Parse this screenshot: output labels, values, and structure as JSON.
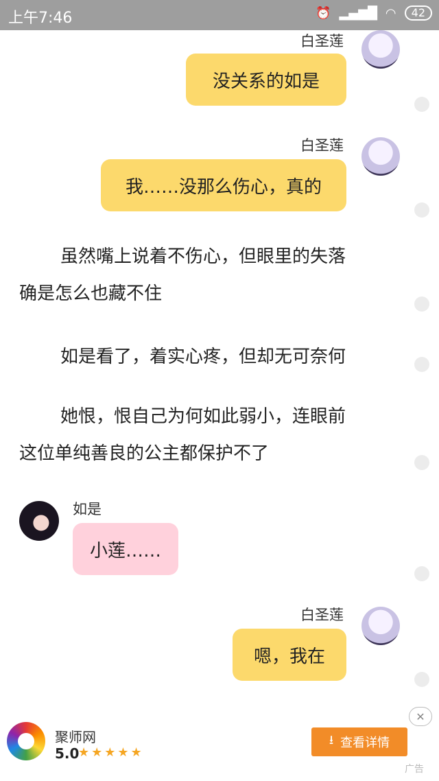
{
  "status_bar": {
    "time": "上午7:46",
    "battery": "42"
  },
  "messages": {
    "m1": {
      "name": "白圣莲",
      "text": "没关系的如是"
    },
    "m2": {
      "name": "白圣莲",
      "text": "我……没那么伤心，真的"
    },
    "m3": {
      "name": "如是",
      "text": "小莲……"
    },
    "m4": {
      "name": "白圣莲",
      "text": "嗯，我在"
    }
  },
  "narration": {
    "p1_line1": "虽然嘴上说着不伤心，但眼里的失落",
    "p1_line2": "确是怎么也藏不住",
    "p2": "如是看了，着实心疼，但却无可奈何",
    "p3_line1": "她恨，恨自己为何如此弱小，连眼前",
    "p3_line2": "这位单纯善良的公主都保护不了"
  },
  "ad": {
    "app_name": "聚师网",
    "rating": "5.0",
    "stars": "★★★★★",
    "button_label": "查看详情",
    "close": "✕",
    "tag": "广告"
  }
}
